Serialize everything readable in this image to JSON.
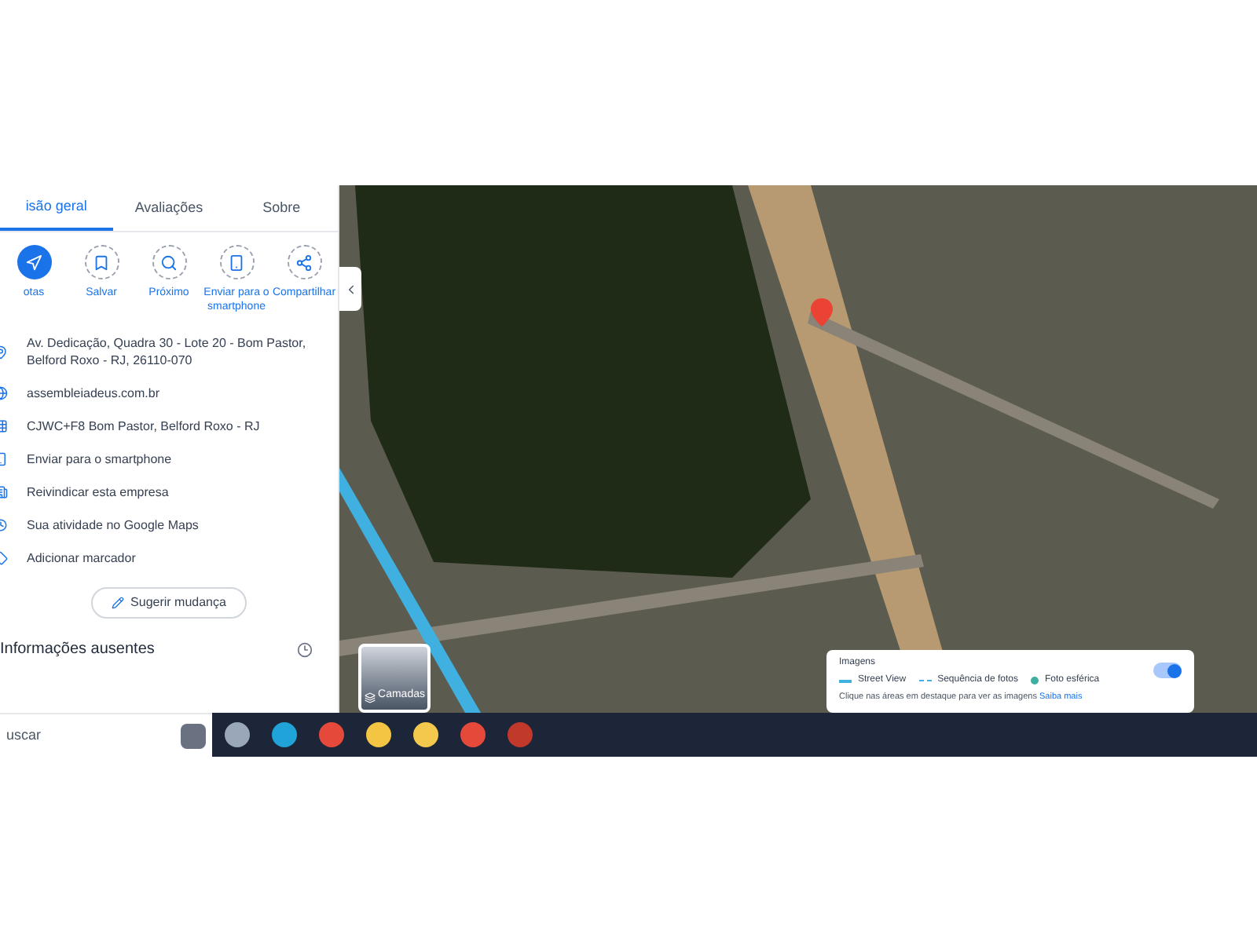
{
  "tabs": [
    {
      "label": "isão geral",
      "selected": true
    },
    {
      "label": "Avaliações",
      "selected": false
    },
    {
      "label": "Sobre",
      "selected": false
    }
  ],
  "actions": [
    {
      "kind": "route",
      "label": "otas",
      "primary": true
    },
    {
      "kind": "save",
      "label": "Salvar",
      "primary": false
    },
    {
      "kind": "nearby",
      "label": "Próximo",
      "primary": false
    },
    {
      "kind": "phone",
      "label": "Enviar para o smartphone",
      "primary": false
    },
    {
      "kind": "share",
      "label": "Compartilhar",
      "primary": false
    }
  ],
  "info_rows": [
    {
      "kind": "pin",
      "text": "Av. Dedicação, Quadra 30 - Lote 20 - Bom Pastor, Belford Roxo - RJ, 26110-070"
    },
    {
      "kind": "globe",
      "text": "assembleiadeus.com.br"
    },
    {
      "kind": "code",
      "text": "CJWC+F8 Bom Pastor, Belford Roxo - RJ"
    },
    {
      "kind": "phone",
      "text": "Enviar para o smartphone"
    },
    {
      "kind": "building",
      "text": "Reivindicar esta empresa"
    },
    {
      "kind": "history",
      "text": "Sua atividade no Google Maps"
    },
    {
      "kind": "label",
      "text": "Adicionar marcador"
    }
  ],
  "suggest_button": "Sugerir mudança",
  "missing_info": "Informações ausentes",
  "map": {
    "layers_label": "Camadas",
    "imagery_card": {
      "title": "Imagens",
      "legend": [
        {
          "kind": "line",
          "label": "Street View"
        },
        {
          "kind": "dots",
          "label": "Sequência de fotos"
        },
        {
          "kind": "sphere",
          "label": "Foto esférica"
        }
      ],
      "hint": "Clique nas áreas em destaque para ver as imagens",
      "link": "Saiba mais",
      "on": true
    }
  },
  "taskbar": {
    "search": "uscar",
    "apps": [
      {
        "kind": "terminal"
      },
      {
        "kind": "edge"
      },
      {
        "kind": "chrome"
      },
      {
        "kind": "files"
      },
      {
        "kind": "notes"
      },
      {
        "kind": "chrome"
      },
      {
        "kind": "pdf"
      }
    ]
  }
}
